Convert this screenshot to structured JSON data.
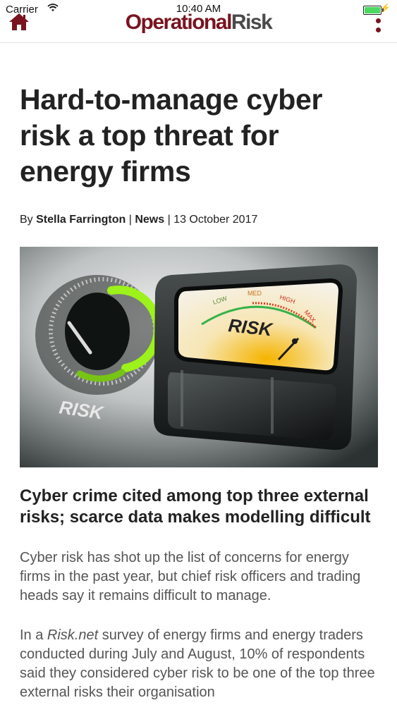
{
  "status_bar": {
    "carrier": "Carrier",
    "time": "10:40 AM"
  },
  "nav": {
    "logo_part1": "Operational",
    "logo_part2": "Risk",
    "home_icon": "home-icon",
    "menu_icon": "more-vertical-icon",
    "brand_color": "#7a1320"
  },
  "article": {
    "headline": "Hard-to-manage cyber risk a top threat for energy firms",
    "byline": {
      "prefix": "By",
      "author": "Stella Farrington",
      "separator1": "|",
      "section": "News",
      "separator2": "|",
      "date": "13 October 2017"
    },
    "image": {
      "knob_label": "RISK",
      "meter_label": "RISK",
      "scale_low": "LOW",
      "scale_med": "MED",
      "scale_high": "HIGH",
      "scale_max": "MAX"
    },
    "subhead": "Cyber crime cited among top three external risks; scarce data makes modelling difficult",
    "paragraph1": "Cyber risk has shot up the list of concerns for energy firms in the past year, but chief risk officers and trading heads say it remains difficult to manage.",
    "paragraph2": {
      "before": "In a ",
      "italic": "Risk.net",
      "after": " survey of energy firms and energy traders conducted during July and August, 10% of respondents said they considered cyber risk to be one of the top three external risks their organisation"
    }
  }
}
